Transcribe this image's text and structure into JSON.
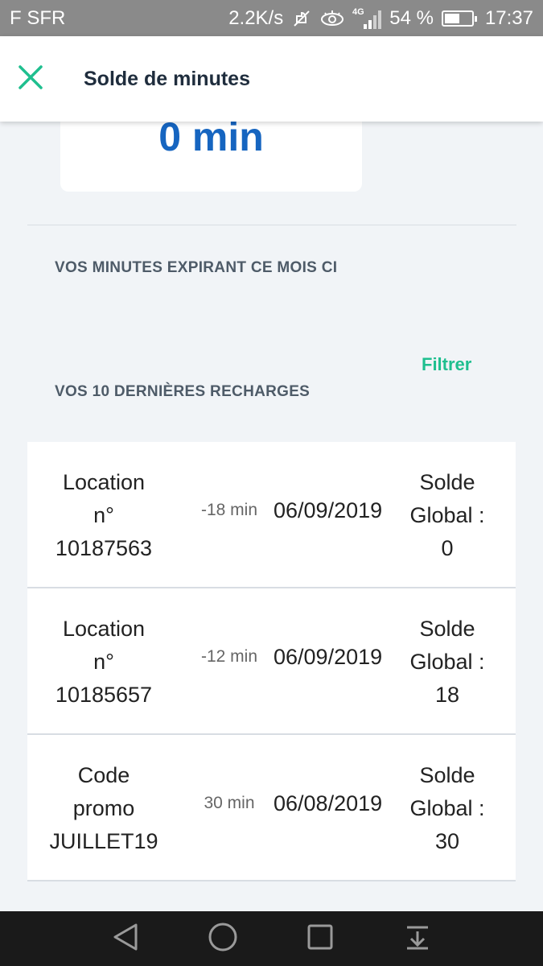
{
  "status_bar": {
    "carrier": "F SFR",
    "speed": "2.2K/s",
    "network": "4G",
    "battery": "54 %",
    "battery_level": 0.54,
    "time": "17:37"
  },
  "header": {
    "title": "Solde de minutes",
    "accent_color": "#1fbf8f"
  },
  "balance": {
    "value": "0 min",
    "color": "#1665c0"
  },
  "sections": {
    "expiring_title": "VOS MINUTES EXPIRANT CE MOIS CI",
    "recharges_title": "VOS 10 DERNIÈRES RECHARGES",
    "filter_label": "Filtrer"
  },
  "recharges": [
    {
      "label": [
        "Location",
        "n°",
        "10187563"
      ],
      "delta": "-18 min",
      "date": "06/09/2019",
      "balance": [
        "Solde",
        "Global :",
        "0"
      ]
    },
    {
      "label": [
        "Location",
        "n°",
        "10185657"
      ],
      "delta": "-12 min",
      "date": "06/09/2019",
      "balance": [
        "Solde",
        "Global :",
        "18"
      ]
    },
    {
      "label": [
        "Code",
        "promo",
        "JUILLET19"
      ],
      "delta": "30 min",
      "date": "06/08/2019",
      "balance": [
        "Solde",
        "Global :",
        "30"
      ]
    }
  ],
  "navbar": {
    "icons": [
      "back-icon",
      "home-icon",
      "recents-icon",
      "notifications-icon"
    ]
  }
}
